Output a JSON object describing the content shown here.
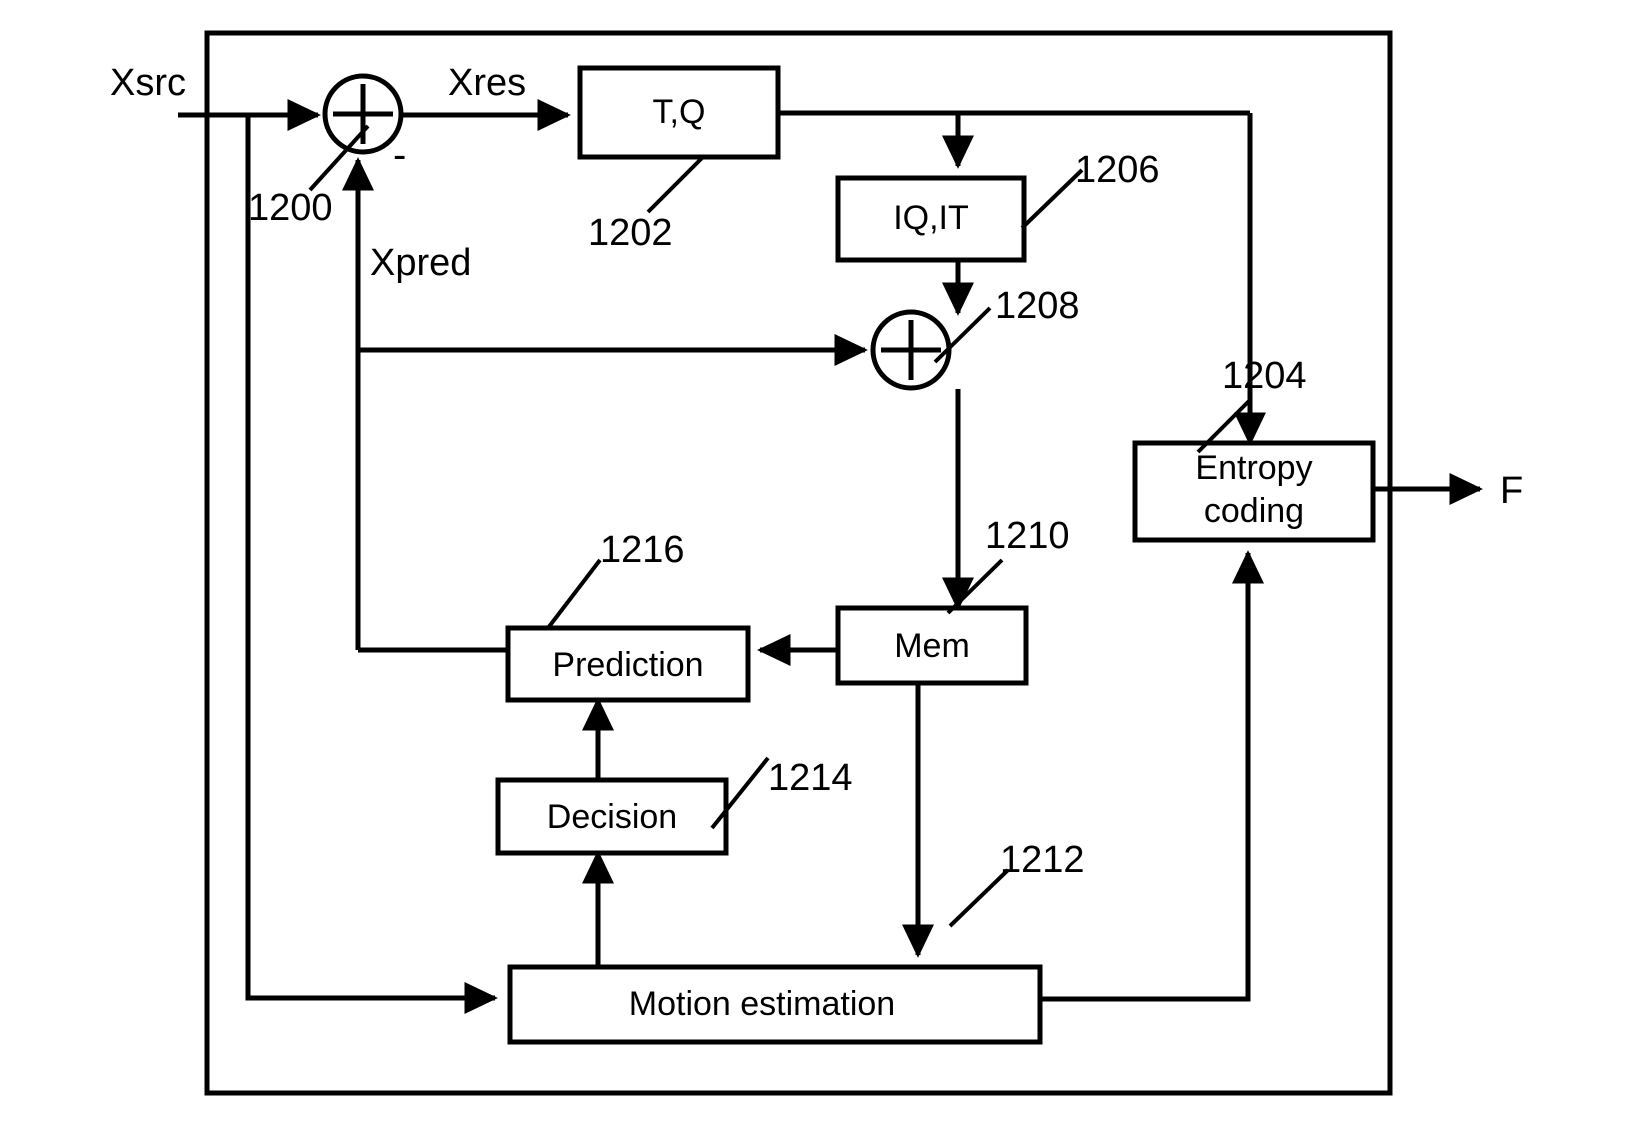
{
  "figure": {
    "type": "video-encoder-block-diagram",
    "outer_frame": {
      "name": "encoder-boundary"
    },
    "blocks": [
      {
        "id": "tq",
        "label": "T,Q",
        "ref": "1202"
      },
      {
        "id": "iqit",
        "label": "IQ,IT",
        "ref": "1206"
      },
      {
        "id": "entropy",
        "label_line1": "Entropy",
        "label_line2": "coding",
        "ref": "1204"
      },
      {
        "id": "mem",
        "label": "Mem",
        "ref": "1210"
      },
      {
        "id": "prediction",
        "label": "Prediction",
        "ref": "1216"
      },
      {
        "id": "decision",
        "label": "Decision",
        "ref": "1214"
      },
      {
        "id": "motion",
        "label": "Motion estimation",
        "ref": "1212"
      }
    ],
    "nodes": [
      {
        "id": "adder-input",
        "symbol": "+",
        "ref": "1200",
        "secondary_sign": "-"
      },
      {
        "id": "adder-recon",
        "symbol": "+",
        "ref": "1208"
      }
    ],
    "signals": [
      {
        "id": "xsrc",
        "label": "Xsrc"
      },
      {
        "id": "xres",
        "label": "Xres"
      },
      {
        "id": "xpred",
        "label": "Xpred"
      },
      {
        "id": "out",
        "label": "F"
      }
    ],
    "reference_numerals": [
      "1200",
      "1202",
      "1204",
      "1206",
      "1208",
      "1210",
      "1212",
      "1214",
      "1216"
    ],
    "colors": {
      "ink": "#000000",
      "paper": "#ffffff"
    }
  }
}
